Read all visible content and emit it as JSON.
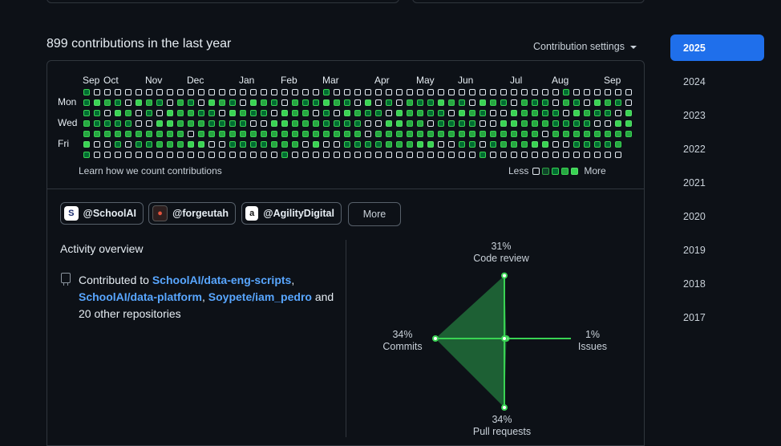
{
  "header": {
    "title": "899 contributions in the last year",
    "settings_label": "Contribution settings"
  },
  "graph": {
    "months": [
      "Sep",
      "Oct",
      "Nov",
      "Dec",
      "Jan",
      "Feb",
      "Mar",
      "Apr",
      "May",
      "Jun",
      "Jul",
      "Aug",
      "Sep"
    ],
    "days": [
      "Mon",
      "Wed",
      "Fri"
    ],
    "learn_link": "Learn how we count contributions",
    "legend_less": "Less",
    "legend_more": "More",
    "colors": {
      "empty": "transparent",
      "l1": "#0e4429",
      "l2": "#006d32",
      "l3": "#26a641",
      "l4": "#39d353"
    }
  },
  "orgs": [
    {
      "name": "@SchoolAI",
      "icon": "schoolai-logo-icon"
    },
    {
      "name": "@forgeutah",
      "icon": "forgeutah-logo-icon"
    },
    {
      "name": "@AgilityDigital",
      "icon": "agilitydigital-logo-icon"
    }
  ],
  "orgs_more": "More",
  "activity": {
    "title": "Activity overview",
    "prefix": "Contributed to ",
    "repos": [
      "SchoolAI/data-eng-scripts",
      "SchoolAI/data-platform",
      "Soypete/iam_pedro"
    ],
    "suffix": " and 20 other repositories",
    "sep1": ",",
    "sep2": ", "
  },
  "radar": {
    "code_review": {
      "pct": "31%",
      "label": "Code review",
      "value": 31
    },
    "issues": {
      "pct": "1%",
      "label": "Issues",
      "value": 1
    },
    "pull_requests": {
      "pct": "34%",
      "label": "Pull requests",
      "value": 34
    },
    "commits": {
      "pct": "34%",
      "label": "Commits",
      "value": 34
    },
    "fill_color": "#216e39",
    "line_color": "#39d353"
  },
  "years": [
    "2025",
    "2024",
    "2023",
    "2022",
    "2021",
    "2020",
    "2019",
    "2018",
    "2017"
  ]
}
